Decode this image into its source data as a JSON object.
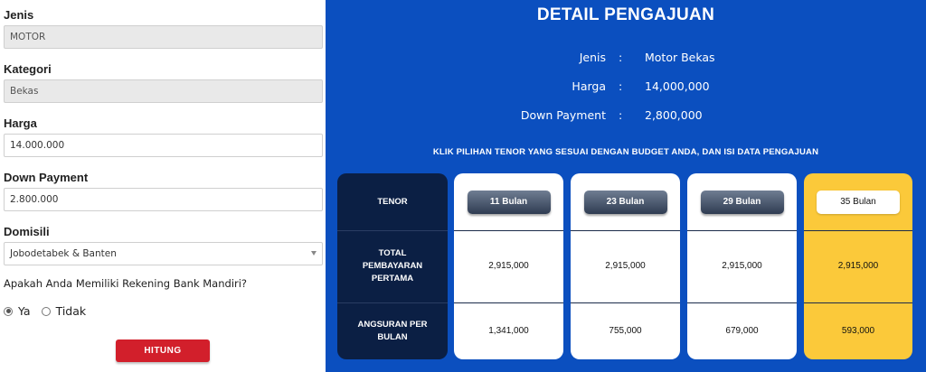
{
  "form": {
    "jenis": {
      "label": "Jenis",
      "value": "MOTOR"
    },
    "kategori": {
      "label": "Kategori",
      "value": "Bekas"
    },
    "harga": {
      "label": "Harga",
      "value": "14.000.000"
    },
    "down_payment": {
      "label": "Down Payment",
      "value": "2.800.000"
    },
    "domisili": {
      "label": "Domisili",
      "value": "Jobodetabek & Banten"
    },
    "bank_question": "Apakah Anda Memiliki Rekening Bank Mandiri?",
    "radio_yes": "Ya",
    "radio_no": "Tidak",
    "submit_label": "HITUNG"
  },
  "detail": {
    "title": "DETAIL PENGAJUAN",
    "colon": ":",
    "rows": [
      {
        "label": "Jenis",
        "value": "Motor Bekas"
      },
      {
        "label": "Harga",
        "value": "14,000,000"
      },
      {
        "label": "Down Payment",
        "value": "2,800,000"
      }
    ],
    "instruction": "KLIK PILIHAN TENOR YANG SESUAI DENGAN BUDGET ANDA, DAN ISI DATA PENGAJUAN"
  },
  "table": {
    "header": {
      "tenor": "TENOR",
      "total": "TOTAL PEMBAYARAN PERTAMA",
      "angsuran": "ANGSURAN PER BULAN"
    },
    "options": [
      {
        "tenor": "11 Bulan",
        "total": "2,915,000",
        "angsuran": "1,341,000",
        "selected": false
      },
      {
        "tenor": "23 Bulan",
        "total": "2,915,000",
        "angsuran": "755,000",
        "selected": false
      },
      {
        "tenor": "29 Bulan",
        "total": "2,915,000",
        "angsuran": "679,000",
        "selected": false
      },
      {
        "tenor": "35 Bulan",
        "total": "2,915,000",
        "angsuran": "593,000",
        "selected": true
      }
    ]
  },
  "colors": {
    "panel_bg": "#0b4fbf",
    "header_card": "#0b1f44",
    "selected_card": "#fbc93a",
    "button_red": "#d21f2b"
  }
}
